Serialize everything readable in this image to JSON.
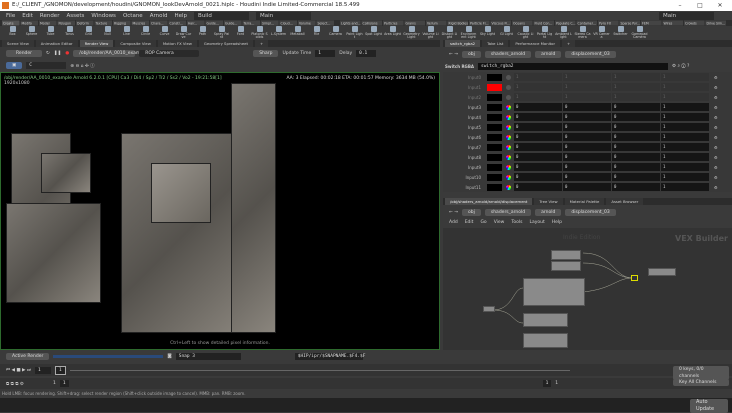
{
  "title": "E:/_CLIENT_/GNOMON/development/houdini/GNOMON_lookDevArnold_0021.hiplc - Houdini Indie Limited-Commercial 18.5.499",
  "menu": [
    "File",
    "Edit",
    "Render",
    "Assets",
    "Windows",
    "Octane",
    "Arnold",
    "Help"
  ],
  "desktop": "Build",
  "desktop2": "Main",
  "desktop3": "Main",
  "shelf_tabs": [
    "Create",
    "Modify",
    "Model",
    "Polygon",
    "Deform",
    "Texture",
    "Rigging",
    "Muscles",
    "Chara...",
    "Constr...",
    "Hair...",
    "Guide...",
    "Guide...",
    "Terra...",
    "Simpl...",
    "Cloud...",
    "Volume",
    "Select...",
    "Lights and...",
    "Collisions",
    "Particles",
    "Grains",
    "Vellum",
    "Rigid Bodies",
    "Particle Fl...",
    "Viscous Fl...",
    "Oceans",
    "Fluid Con...",
    "Populate C...",
    "Container...",
    "Pyro FX",
    "Sparse Pyr...",
    "FEM",
    "Wires",
    "Crowds",
    "Drive Sim..."
  ],
  "shelf_tools": [
    "Box",
    "Sphere",
    "Tube",
    "Torus",
    "Grid",
    "Null",
    "Line",
    "Circle",
    "Curve",
    "Draw Curve",
    "Path",
    "Spray Paint",
    "Font",
    "Platonic Solids",
    "L-System",
    "Metaball",
    "File",
    "Camera",
    "Point Light",
    "Spot Light",
    "Area Light",
    "Geometry Light",
    "Volume Light",
    "Distant Light",
    "Environment Light",
    "Sky Light",
    "GI Light",
    "Caustic Light",
    "Portal Light",
    "Ambient Light",
    "Stereo Camera",
    "VR Camera",
    "Switcher",
    "Gamepad Camera"
  ],
  "left_tabs": [
    "Scene View",
    "Animation Editor",
    "Render View",
    "Composite View",
    "Motion FX View",
    "Geometry Spreadsheet"
  ],
  "render": {
    "render_label": "Render",
    "rop_path": "/obj/render/AA_0010_example",
    "camera": "ROP Camera",
    "sharp": "Sharp",
    "update_label": "Update Time",
    "update_value": "1",
    "delay_label": "Delay",
    "delay_value": "0.1",
    "cam_field": "C"
  },
  "viewport": {
    "info": "/obj/render/AA_0010_example  Arnold 6.2.0.1 [CPU]  Ca3 / Di4 / Sp2 / Tr2 / Ss2 / Vo2 - 19:21:58[1]",
    "res": "1920x1080",
    "stats": "AA: 3  Elapsed: 00:02:18  ETA: 00:01:57  Memory: 3634 MB  (54.0%)",
    "hint": "Ctrl+Left to show detailed pixel information."
  },
  "status": {
    "active_render": "Active Render",
    "snap": "Snap 3",
    "snap_path": "$HIP/ipr/$SNAPNAME.$F4.$F"
  },
  "timeline": {
    "frame": "1",
    "marker": "1",
    "start": "1",
    "end": "1",
    "range_start": "1",
    "range_end": "1"
  },
  "help_text": "Hold LMB: focus rendering. Shift+drag: select render region (Shift+click outside image to cancel). MMB: pan. RMB: zoom.",
  "right_tabs": [
    "switch_rgba2",
    "Take List",
    "Performance Monitor"
  ],
  "path": [
    "obj",
    "shaders_arnold",
    "arnold",
    "displacement_03"
  ],
  "param": {
    "type": "Switch RGBA",
    "name": "switch_rgba2"
  },
  "rows": [
    {
      "label": "Input0",
      "color": "#000000",
      "v": [
        "1",
        "1",
        "1",
        "1"
      ],
      "dis": true
    },
    {
      "label": "Input1",
      "color": "#ff0000",
      "v": [
        "1",
        "1",
        "1",
        "1"
      ],
      "dis": true
    },
    {
      "label": "Input2",
      "color": "#000000",
      "v": [
        "1",
        "1",
        "1",
        "1"
      ],
      "dis": true
    },
    {
      "label": "Input3",
      "color": "#000000",
      "v": [
        "0",
        "0",
        "0",
        "1"
      ]
    },
    {
      "label": "Input4",
      "color": "#000000",
      "v": [
        "0",
        "0",
        "0",
        "1"
      ]
    },
    {
      "label": "Input5",
      "color": "#000000",
      "v": [
        "0",
        "0",
        "0",
        "1"
      ]
    },
    {
      "label": "Input6",
      "color": "#000000",
      "v": [
        "0",
        "0",
        "0",
        "1"
      ]
    },
    {
      "label": "Input7",
      "color": "#000000",
      "v": [
        "0",
        "0",
        "0",
        "1"
      ]
    },
    {
      "label": "Input8",
      "color": "#000000",
      "v": [
        "0",
        "0",
        "0",
        "1"
      ]
    },
    {
      "label": "Input9",
      "color": "#000000",
      "v": [
        "0",
        "0",
        "0",
        "1"
      ]
    },
    {
      "label": "Input10",
      "color": "#000000",
      "v": [
        "0",
        "0",
        "0",
        "1"
      ]
    },
    {
      "label": "Input11",
      "color": "#000000",
      "v": [
        "0",
        "0",
        "0",
        "1"
      ]
    }
  ],
  "net_tabs": [
    "/obj/shaders_arnold/arnold/displacement",
    "Tree View",
    "Material Palette",
    "Asset Browser"
  ],
  "net_menu": [
    "Add",
    "Edit",
    "Go",
    "View",
    "Tools",
    "Layout",
    "Help"
  ],
  "net": {
    "watermark": "Indie Edition",
    "context": "VEX Builder"
  },
  "keys": {
    "channels": "0 keys, 0/0 channels",
    "key_all": "Key All Channels",
    "auto_update": "Auto Update"
  }
}
